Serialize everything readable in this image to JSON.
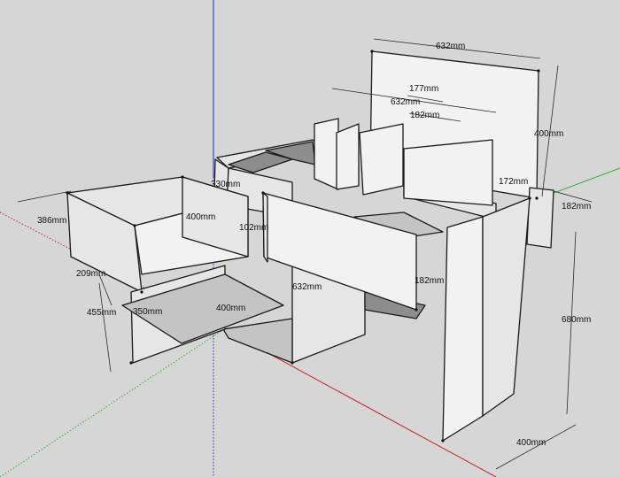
{
  "colors": {
    "background": "#d6d6d6",
    "axis_x": "#cc2222",
    "axis_y": "#2fae2f",
    "axis_z": "#2222cc"
  },
  "dimensions": {
    "top_back_width": "632mm",
    "top_back_height": "400mm",
    "inner_depth": "177mm",
    "mid_width": "632mm",
    "mid_depth": "182mm",
    "side_depth_a": "182mm",
    "side_depth_b": "172mm",
    "left_drawer_depth": "386mm",
    "left_drawer_width": "400mm",
    "left_drawer_height": "209mm",
    "upper_offset": "330mm",
    "small_gap": "102mm",
    "shelf_width": "400mm",
    "shelf_depth": "350mm",
    "lower_height": "455mm",
    "front_width": "632mm",
    "front_height": "182mm",
    "total_height": "680mm",
    "base_depth": "400mm"
  }
}
